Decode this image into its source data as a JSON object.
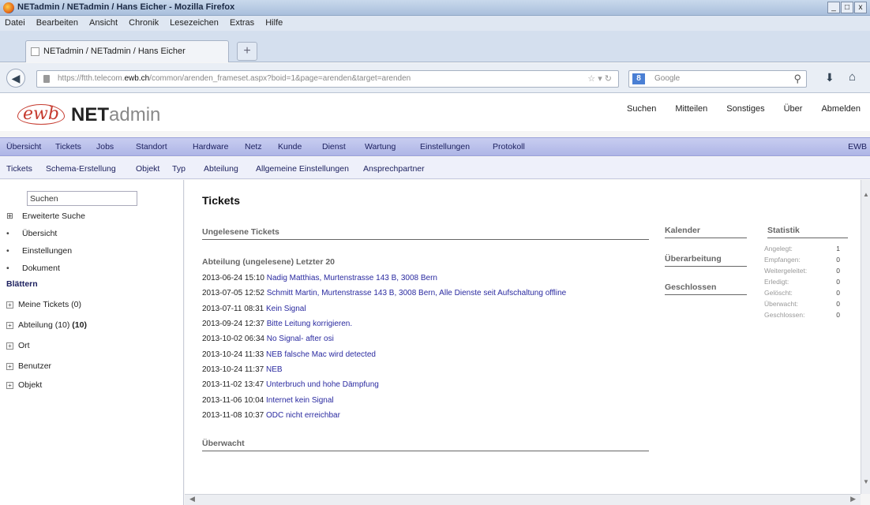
{
  "window": {
    "title": "NETadmin / NETadmin / Hans Eicher - Mozilla Firefox",
    "controls": [
      "_",
      "□",
      "x"
    ]
  },
  "menubar": [
    "Datei",
    "Bearbeiten",
    "Ansicht",
    "Chronik",
    "Lesezeichen",
    "Extras",
    "Hilfe"
  ],
  "tab": {
    "label": "NETadmin / NETadmin / Hans Eicher",
    "new_tab": "+"
  },
  "navbar": {
    "url_prefix": "https://ftth.telecom.",
    "url_host": "ewb.ch",
    "url_rest": "/common/arenden_frameset.aspx?boid=1&page=arenden&target=arenden",
    "search_placeholder": "Google",
    "search_engine": "8"
  },
  "app": {
    "logo_ewb": "ewb",
    "logo_net": "NET",
    "logo_admin": "admin",
    "topnav": [
      "Suchen",
      "Mitteilen",
      "Sonstiges",
      "Über",
      "Abmelden"
    ]
  },
  "mainnav": {
    "items": [
      "Übersicht",
      "Tickets",
      "Jobs",
      "Standort",
      "Hardware",
      "Netz",
      "Kunde",
      "Dienst",
      "Wartung",
      "Einstellungen",
      "Protokoll"
    ],
    "right": "EWB"
  },
  "subnav": [
    "Tickets",
    "Schema-Erstellung",
    "Objekt",
    "Typ",
    "Abteilung",
    "Allgemeine Einstellungen",
    "Ansprechpartner"
  ],
  "sidebar": {
    "search_value": "Suchen",
    "items_top": [
      {
        "marker": "⊞",
        "label": "Erweiterte Suche"
      },
      {
        "marker": "•",
        "label": "Übersicht"
      },
      {
        "marker": "•",
        "label": "Einstellungen"
      },
      {
        "marker": "•",
        "label": "Dokument"
      }
    ],
    "section": "Blättern",
    "tree": [
      {
        "label": "Meine Tickets (0)",
        "bold": ""
      },
      {
        "label": "Abteilung (10) ",
        "bold": "(10)"
      },
      {
        "label": "Ort",
        "bold": ""
      },
      {
        "label": "Benutzer",
        "bold": ""
      },
      {
        "label": "Objekt",
        "bold": ""
      }
    ]
  },
  "content": {
    "title": "Tickets",
    "sections": {
      "unread": "Ungelesene Tickets",
      "dept": "Abteilung (ungelesene) Letzter 20",
      "watched": "Überwacht",
      "calendar": "Kalender",
      "revision": "Überarbeitung",
      "closed": "Geschlossen",
      "stats": "Statistik"
    },
    "tickets": [
      {
        "date": "2013-06-24 15:10",
        "text": "Nadig Matthias, Murtenstrasse 143 B, 3008 Bern"
      },
      {
        "date": "2013-07-05 12:52",
        "text": "Schmitt Martin, Murtenstrasse 143 B, 3008 Bern, Alle Dienste seit Aufschaltung offline"
      },
      {
        "date": "2013-07-11 08:31",
        "text": "Kein Signal"
      },
      {
        "date": "2013-09-24 12:37",
        "text": "Bitte Leitung korrigieren."
      },
      {
        "date": "2013-10-02 06:34",
        "text": "No Signal- after osi"
      },
      {
        "date": "2013-10-24 11:33",
        "text": "NEB falsche Mac wird detected"
      },
      {
        "date": "2013-10-24 11:37",
        "text": "NEB"
      },
      {
        "date": "2013-11-02 13:47",
        "text": "Unterbruch und hohe Dämpfung"
      },
      {
        "date": "2013-11-06 10:04",
        "text": "Internet kein Signal"
      },
      {
        "date": "2013-11-08 10:37",
        "text": "ODC nicht erreichbar"
      }
    ],
    "stats": [
      {
        "label": "Angelegt:",
        "value": "1"
      },
      {
        "label": "Empfangen:",
        "value": "0"
      },
      {
        "label": "Weitergeleitet:",
        "value": "0"
      },
      {
        "label": "Erledigt:",
        "value": "0"
      },
      {
        "label": "Gelöscht:",
        "value": "0"
      },
      {
        "label": "Überwacht:",
        "value": "0"
      },
      {
        "label": "Geschlossen:",
        "value": "0"
      }
    ]
  }
}
